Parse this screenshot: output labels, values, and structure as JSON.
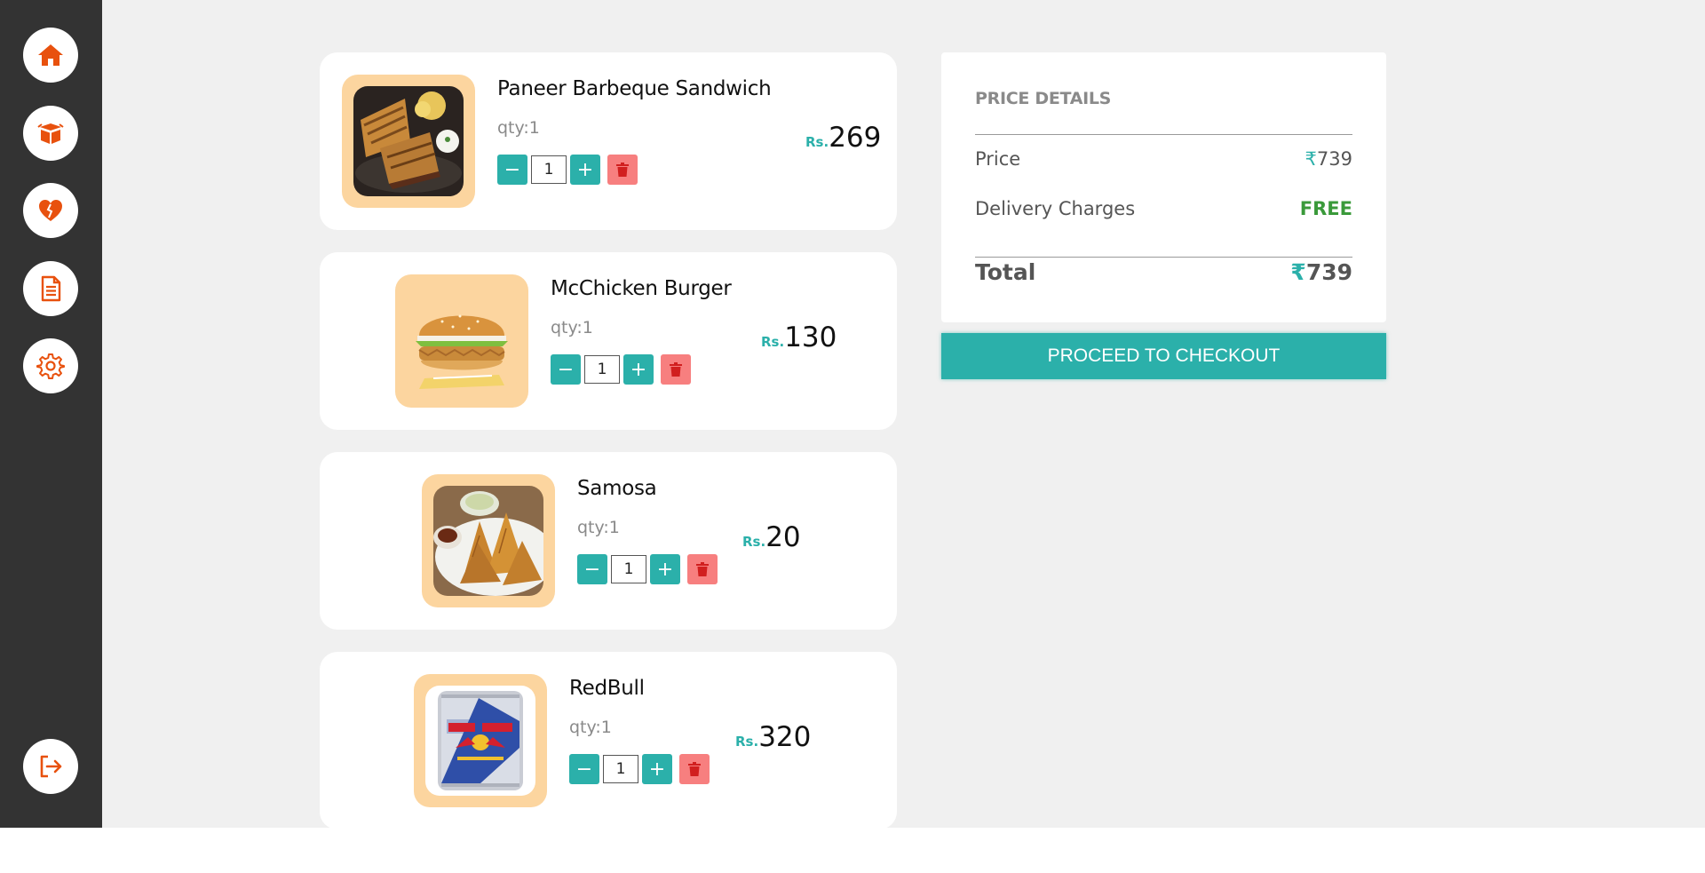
{
  "sidebar": {
    "nav": [
      {
        "icon": "home-icon"
      },
      {
        "icon": "box-icon"
      },
      {
        "icon": "heart-icon"
      },
      {
        "icon": "document-icon"
      },
      {
        "icon": "gear-icon"
      }
    ],
    "logout_icon": "logout-icon"
  },
  "cart": {
    "items": [
      {
        "name": "Paneer Barbeque Sandwich",
        "qty_label": "qty:1",
        "qty": "1",
        "currency": "Rs.",
        "price": "269"
      },
      {
        "name": "McChicken Burger",
        "qty_label": "qty:1",
        "qty": "1",
        "currency": "Rs.",
        "price": "130"
      },
      {
        "name": "Samosa",
        "qty_label": "qty:1",
        "qty": "1",
        "currency": "Rs.",
        "price": "20"
      },
      {
        "name": "RedBull",
        "qty_label": "qty:1",
        "qty": "1",
        "currency": "Rs.",
        "price": "320"
      }
    ]
  },
  "price_details": {
    "title": "PRICE DETAILS",
    "price_label": "Price",
    "price_symbol": "₹",
    "price_value": "739",
    "delivery_label": "Delivery Charges",
    "delivery_value": "FREE",
    "total_label": "Total",
    "total_symbol": "₹",
    "total_value": "739"
  },
  "checkout_label": "PROCEED TO CHECKOUT",
  "colors": {
    "accent": "#2bb0aa",
    "brand_orange": "#e8510e",
    "sidebar": "#333333",
    "image_frame": "#fcd59f",
    "delete": "#f77f7f",
    "free": "#3a9a3a"
  }
}
